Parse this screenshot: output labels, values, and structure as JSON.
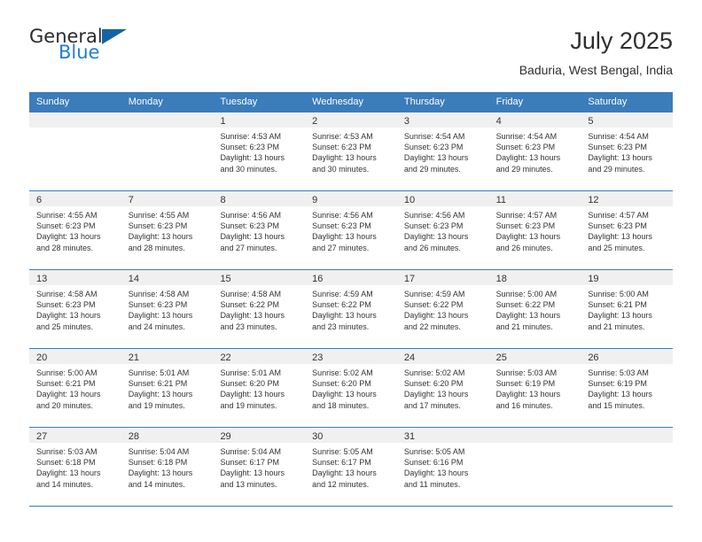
{
  "logo": {
    "word_one": "General",
    "word_two": "Blue",
    "triangle_color": "#1464a5",
    "blue_color": "#1f7fd0"
  },
  "header": {
    "title": "July 2025",
    "subtitle": "Baduria, West Bengal, India"
  },
  "theme": {
    "header_bg": "#3b7cba",
    "header_text": "#ffffff",
    "day_band_bg": "#f0f0f0",
    "grid_line": "#3b7cba",
    "body_text": "#333333"
  },
  "weekday_headers": [
    "Sunday",
    "Monday",
    "Tuesday",
    "Wednesday",
    "Thursday",
    "Friday",
    "Saturday"
  ],
  "weeks": [
    [
      {
        "day": "",
        "empty": true,
        "sunrise": "",
        "sunset": "",
        "daylight_line1": "",
        "daylight_line2": ""
      },
      {
        "day": "",
        "empty": true,
        "sunrise": "",
        "sunset": "",
        "daylight_line1": "",
        "daylight_line2": ""
      },
      {
        "day": "1",
        "empty": false,
        "sunrise": "Sunrise: 4:53 AM",
        "sunset": "Sunset: 6:23 PM",
        "daylight_line1": "Daylight: 13 hours",
        "daylight_line2": "and 30 minutes."
      },
      {
        "day": "2",
        "empty": false,
        "sunrise": "Sunrise: 4:53 AM",
        "sunset": "Sunset: 6:23 PM",
        "daylight_line1": "Daylight: 13 hours",
        "daylight_line2": "and 30 minutes."
      },
      {
        "day": "3",
        "empty": false,
        "sunrise": "Sunrise: 4:54 AM",
        "sunset": "Sunset: 6:23 PM",
        "daylight_line1": "Daylight: 13 hours",
        "daylight_line2": "and 29 minutes."
      },
      {
        "day": "4",
        "empty": false,
        "sunrise": "Sunrise: 4:54 AM",
        "sunset": "Sunset: 6:23 PM",
        "daylight_line1": "Daylight: 13 hours",
        "daylight_line2": "and 29 minutes."
      },
      {
        "day": "5",
        "empty": false,
        "sunrise": "Sunrise: 4:54 AM",
        "sunset": "Sunset: 6:23 PM",
        "daylight_line1": "Daylight: 13 hours",
        "daylight_line2": "and 29 minutes."
      }
    ],
    [
      {
        "day": "6",
        "empty": false,
        "sunrise": "Sunrise: 4:55 AM",
        "sunset": "Sunset: 6:23 PM",
        "daylight_line1": "Daylight: 13 hours",
        "daylight_line2": "and 28 minutes."
      },
      {
        "day": "7",
        "empty": false,
        "sunrise": "Sunrise: 4:55 AM",
        "sunset": "Sunset: 6:23 PM",
        "daylight_line1": "Daylight: 13 hours",
        "daylight_line2": "and 28 minutes."
      },
      {
        "day": "8",
        "empty": false,
        "sunrise": "Sunrise: 4:56 AM",
        "sunset": "Sunset: 6:23 PM",
        "daylight_line1": "Daylight: 13 hours",
        "daylight_line2": "and 27 minutes."
      },
      {
        "day": "9",
        "empty": false,
        "sunrise": "Sunrise: 4:56 AM",
        "sunset": "Sunset: 6:23 PM",
        "daylight_line1": "Daylight: 13 hours",
        "daylight_line2": "and 27 minutes."
      },
      {
        "day": "10",
        "empty": false,
        "sunrise": "Sunrise: 4:56 AM",
        "sunset": "Sunset: 6:23 PM",
        "daylight_line1": "Daylight: 13 hours",
        "daylight_line2": "and 26 minutes."
      },
      {
        "day": "11",
        "empty": false,
        "sunrise": "Sunrise: 4:57 AM",
        "sunset": "Sunset: 6:23 PM",
        "daylight_line1": "Daylight: 13 hours",
        "daylight_line2": "and 26 minutes."
      },
      {
        "day": "12",
        "empty": false,
        "sunrise": "Sunrise: 4:57 AM",
        "sunset": "Sunset: 6:23 PM",
        "daylight_line1": "Daylight: 13 hours",
        "daylight_line2": "and 25 minutes."
      }
    ],
    [
      {
        "day": "13",
        "empty": false,
        "sunrise": "Sunrise: 4:58 AM",
        "sunset": "Sunset: 6:23 PM",
        "daylight_line1": "Daylight: 13 hours",
        "daylight_line2": "and 25 minutes."
      },
      {
        "day": "14",
        "empty": false,
        "sunrise": "Sunrise: 4:58 AM",
        "sunset": "Sunset: 6:23 PM",
        "daylight_line1": "Daylight: 13 hours",
        "daylight_line2": "and 24 minutes."
      },
      {
        "day": "15",
        "empty": false,
        "sunrise": "Sunrise: 4:58 AM",
        "sunset": "Sunset: 6:22 PM",
        "daylight_line1": "Daylight: 13 hours",
        "daylight_line2": "and 23 minutes."
      },
      {
        "day": "16",
        "empty": false,
        "sunrise": "Sunrise: 4:59 AM",
        "sunset": "Sunset: 6:22 PM",
        "daylight_line1": "Daylight: 13 hours",
        "daylight_line2": "and 23 minutes."
      },
      {
        "day": "17",
        "empty": false,
        "sunrise": "Sunrise: 4:59 AM",
        "sunset": "Sunset: 6:22 PM",
        "daylight_line1": "Daylight: 13 hours",
        "daylight_line2": "and 22 minutes."
      },
      {
        "day": "18",
        "empty": false,
        "sunrise": "Sunrise: 5:00 AM",
        "sunset": "Sunset: 6:22 PM",
        "daylight_line1": "Daylight: 13 hours",
        "daylight_line2": "and 21 minutes."
      },
      {
        "day": "19",
        "empty": false,
        "sunrise": "Sunrise: 5:00 AM",
        "sunset": "Sunset: 6:21 PM",
        "daylight_line1": "Daylight: 13 hours",
        "daylight_line2": "and 21 minutes."
      }
    ],
    [
      {
        "day": "20",
        "empty": false,
        "sunrise": "Sunrise: 5:00 AM",
        "sunset": "Sunset: 6:21 PM",
        "daylight_line1": "Daylight: 13 hours",
        "daylight_line2": "and 20 minutes."
      },
      {
        "day": "21",
        "empty": false,
        "sunrise": "Sunrise: 5:01 AM",
        "sunset": "Sunset: 6:21 PM",
        "daylight_line1": "Daylight: 13 hours",
        "daylight_line2": "and 19 minutes."
      },
      {
        "day": "22",
        "empty": false,
        "sunrise": "Sunrise: 5:01 AM",
        "sunset": "Sunset: 6:20 PM",
        "daylight_line1": "Daylight: 13 hours",
        "daylight_line2": "and 19 minutes."
      },
      {
        "day": "23",
        "empty": false,
        "sunrise": "Sunrise: 5:02 AM",
        "sunset": "Sunset: 6:20 PM",
        "daylight_line1": "Daylight: 13 hours",
        "daylight_line2": "and 18 minutes."
      },
      {
        "day": "24",
        "empty": false,
        "sunrise": "Sunrise: 5:02 AM",
        "sunset": "Sunset: 6:20 PM",
        "daylight_line1": "Daylight: 13 hours",
        "daylight_line2": "and 17 minutes."
      },
      {
        "day": "25",
        "empty": false,
        "sunrise": "Sunrise: 5:03 AM",
        "sunset": "Sunset: 6:19 PM",
        "daylight_line1": "Daylight: 13 hours",
        "daylight_line2": "and 16 minutes."
      },
      {
        "day": "26",
        "empty": false,
        "sunrise": "Sunrise: 5:03 AM",
        "sunset": "Sunset: 6:19 PM",
        "daylight_line1": "Daylight: 13 hours",
        "daylight_line2": "and 15 minutes."
      }
    ],
    [
      {
        "day": "27",
        "empty": false,
        "sunrise": "Sunrise: 5:03 AM",
        "sunset": "Sunset: 6:18 PM",
        "daylight_line1": "Daylight: 13 hours",
        "daylight_line2": "and 14 minutes."
      },
      {
        "day": "28",
        "empty": false,
        "sunrise": "Sunrise: 5:04 AM",
        "sunset": "Sunset: 6:18 PM",
        "daylight_line1": "Daylight: 13 hours",
        "daylight_line2": "and 14 minutes."
      },
      {
        "day": "29",
        "empty": false,
        "sunrise": "Sunrise: 5:04 AM",
        "sunset": "Sunset: 6:17 PM",
        "daylight_line1": "Daylight: 13 hours",
        "daylight_line2": "and 13 minutes."
      },
      {
        "day": "30",
        "empty": false,
        "sunrise": "Sunrise: 5:05 AM",
        "sunset": "Sunset: 6:17 PM",
        "daylight_line1": "Daylight: 13 hours",
        "daylight_line2": "and 12 minutes."
      },
      {
        "day": "31",
        "empty": false,
        "sunrise": "Sunrise: 5:05 AM",
        "sunset": "Sunset: 6:16 PM",
        "daylight_line1": "Daylight: 13 hours",
        "daylight_line2": "and 11 minutes."
      },
      {
        "day": "",
        "empty": true,
        "sunrise": "",
        "sunset": "",
        "daylight_line1": "",
        "daylight_line2": ""
      },
      {
        "day": "",
        "empty": true,
        "sunrise": "",
        "sunset": "",
        "daylight_line1": "",
        "daylight_line2": ""
      }
    ]
  ]
}
